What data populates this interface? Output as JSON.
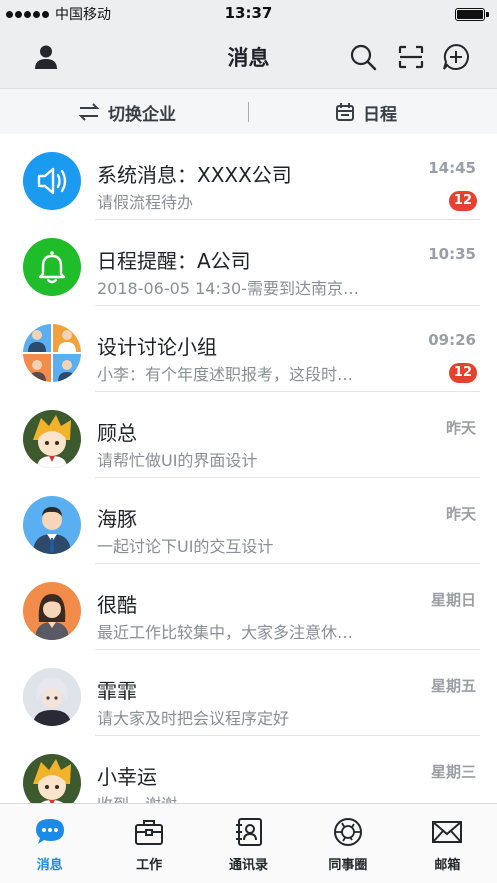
{
  "status_bar": {
    "carrier": "中国移动",
    "time": "13:37"
  },
  "header": {
    "title": "消息"
  },
  "subbar": {
    "switch_company": "切换企业",
    "schedule": "日程"
  },
  "messages": [
    {
      "title": "系统消息：XXXX公司",
      "subtitle": "请假流程待办",
      "time": "14:45",
      "badge": "12",
      "avatar": "speaker-icon",
      "color": "#1a9bf0"
    },
    {
      "title": "日程提醒：A公司",
      "subtitle": "2018-06-05 14:30-需要到达南京…",
      "time": "10:35",
      "badge": "",
      "avatar": "bell-icon",
      "color": "#1fbd2a"
    },
    {
      "title": "设计讨论小组",
      "subtitle": "小李：有个年度述职报考，这段时…",
      "time": "09:26",
      "badge": "12",
      "avatar": "group-avatar",
      "color": "#f2a23c"
    },
    {
      "title": "顾总",
      "subtitle": "请帮忙做UI的界面设计",
      "time": "昨天",
      "badge": "",
      "avatar": "anime-avatar",
      "color": "#f2b32a"
    },
    {
      "title": "海豚",
      "subtitle": "一起讨论下UI的交互设计",
      "time": "昨天",
      "badge": "",
      "avatar": "man-avatar",
      "color": "#5aaff0"
    },
    {
      "title": "很酷",
      "subtitle": "最近工作比较集中，大家多注意休…",
      "time": "星期日",
      "badge": "",
      "avatar": "woman-avatar",
      "color": "#f28c4a"
    },
    {
      "title": "霏霏",
      "subtitle": "请大家及时把会议程序定好",
      "time": "星期五",
      "badge": "",
      "avatar": "portrait-avatar",
      "color": "#cfd6de"
    },
    {
      "title": "小幸运",
      "subtitle": "收到，谢谢",
      "time": "星期三",
      "badge": "",
      "avatar": "anime-avatar",
      "color": "#f2b32a"
    }
  ],
  "tabs": [
    {
      "label": "消息",
      "icon": "chat-bubble-icon",
      "active": true
    },
    {
      "label": "工作",
      "icon": "briefcase-icon",
      "active": false
    },
    {
      "label": "通讯录",
      "icon": "contacts-icon",
      "active": false
    },
    {
      "label": "同事圈",
      "icon": "aperture-icon",
      "active": false
    },
    {
      "label": "邮箱",
      "icon": "mail-icon",
      "active": false
    }
  ],
  "colors": {
    "accent": "#1a8be8",
    "badge": "#e5412f",
    "header_bg": "#eceef0"
  }
}
